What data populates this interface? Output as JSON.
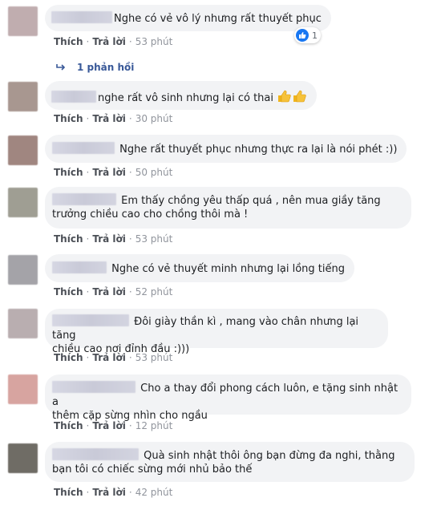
{
  "actions": {
    "like": "Thích",
    "reply": "Trả lời",
    "separator": "·"
  },
  "comments": [
    {
      "text": "Nghe có vẻ vô lý nhưng rất thuyết phục",
      "time": "53 phút",
      "reaction_count": "1",
      "avatar_color": "#c0adaf",
      "reply_link": "1 phản hồi"
    },
    {
      "text": "nghe rất vô sinh nhưng lại có thai",
      "time": "30 phút",
      "avatar_color": "#a89790",
      "emoji": "thumbs-up-emoji ×2"
    },
    {
      "text": "Nghe rất thuyết phục nhưng thực ra lại là nói phét :))",
      "time": "50 phút",
      "avatar_color": "#a08680"
    },
    {
      "text_line1": "Em thấy chồng yêu thấp quá , nên mua giầy tăng",
      "text_line2": "trưởng chiều cao cho chồng thôi mà !",
      "time": "53 phút",
      "avatar_color": "#9f9e93"
    },
    {
      "text": "Nghe có vẻ thuyết minh nhưng lại lồng tiếng",
      "time": "52 phút",
      "avatar_color": "#a4a3a8"
    },
    {
      "text_line1": "Đôi giày thần kì , mang vào chân nhưng lại tăng",
      "text_line2": "chiều cao nơi đỉnh đầu :)))",
      "time": "53 phút",
      "avatar_color": "#b9aeb0"
    },
    {
      "text_line1": "Cho a thay đổi phong cách luôn, e tặng sinh nhật a",
      "text_line2": "thêm cặp sừng nhìn cho ngầu",
      "time": "12 phút",
      "avatar_color": "#d7a4a0"
    },
    {
      "text_line1": "Quà sinh nhật thôi ông bạn đừng đa nghi, thằng",
      "text_line2": "bạn tôi có chiếc sừng mới nhủ bảo thế",
      "time": "42 phút",
      "avatar_color": "#6f6c65"
    }
  ]
}
